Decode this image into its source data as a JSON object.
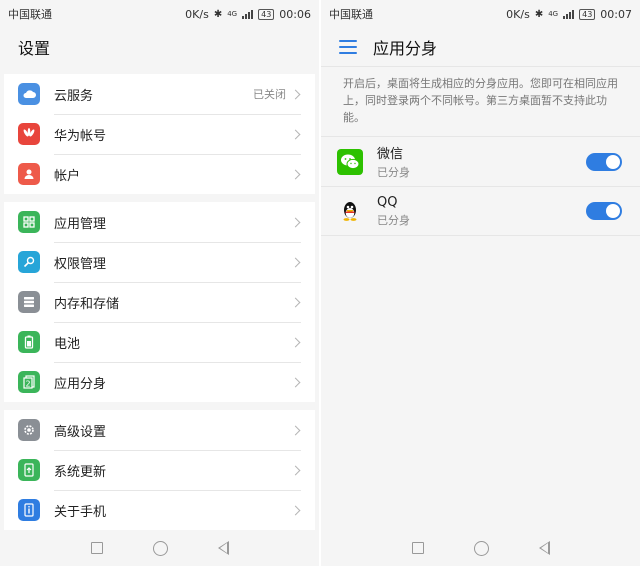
{
  "left": {
    "status": {
      "carrier": "中国联通",
      "speed": "0K/s",
      "bt": "✱",
      "network": "4G",
      "battery": "43",
      "time": "00:06"
    },
    "title": "设置",
    "groups": [
      [
        {
          "label": "云服务",
          "value": "已关闭",
          "icon": "cloud-icon",
          "color": "#4a90e2"
        },
        {
          "label": "华为帐号",
          "icon": "huawei-icon",
          "color": "#e8453c"
        },
        {
          "label": "帐户",
          "icon": "account-icon",
          "color": "#ee5a4a"
        }
      ],
      [
        {
          "label": "应用管理",
          "icon": "apps-icon",
          "color": "#3bb55a"
        },
        {
          "label": "权限管理",
          "icon": "key-icon",
          "color": "#27a5d8"
        },
        {
          "label": "内存和存储",
          "icon": "storage-icon",
          "color": "#8a8f95"
        },
        {
          "label": "电池",
          "icon": "battery-icon",
          "color": "#3bb55a"
        },
        {
          "label": "应用分身",
          "icon": "app-twin-icon",
          "color": "#3bb55a"
        }
      ],
      [
        {
          "label": "高级设置",
          "icon": "gear-icon",
          "color": "#8a8f95"
        },
        {
          "label": "系统更新",
          "icon": "update-icon",
          "color": "#3bb55a"
        },
        {
          "label": "关于手机",
          "icon": "phone-info-icon",
          "color": "#2f7de1"
        }
      ]
    ]
  },
  "right": {
    "status": {
      "carrier": "中国联通",
      "speed": "0K/s",
      "bt": "✱",
      "network": "4G",
      "battery": "43",
      "time": "00:07"
    },
    "title": "应用分身",
    "description": "开启后，桌面将生成相应的分身应用。您即可在相同应用上，同时登录两个不同帐号。第三方桌面暂不支持此功能。",
    "apps": [
      {
        "name": "微信",
        "sub": "已分身",
        "icon": "wechat-icon",
        "enabled": true
      },
      {
        "name": "QQ",
        "sub": "已分身",
        "icon": "qq-icon",
        "enabled": true
      }
    ]
  },
  "colors": {
    "accent": "#2f7de1",
    "wechat": "#2dc100"
  }
}
